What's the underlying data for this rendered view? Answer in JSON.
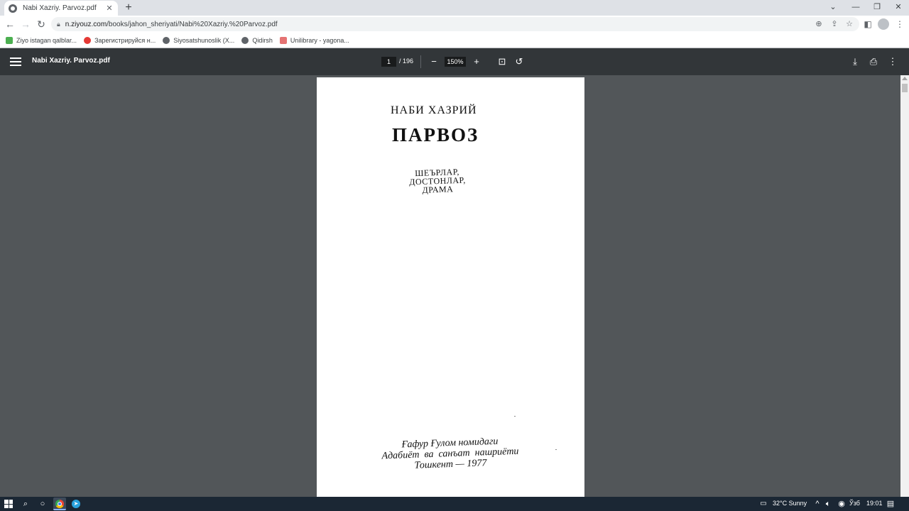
{
  "browser": {
    "tab_title": "Nabi Xazriy. Parvoz.pdf",
    "tab_close": "✕",
    "new_tab": "+",
    "url_host": "n.ziyouz.com",
    "url_path": "/books/jahon_sheriyati/Nabi%20Xazriy.%20Parvoz.pdf",
    "window_controls": [
      "⌄",
      "—",
      "❐",
      "✕"
    ]
  },
  "bookmarks": [
    {
      "label": "Ziyo istagan qalblar...",
      "color": "#4caf50"
    },
    {
      "label": "Зарегистрируйся н...",
      "color": "#e53935"
    },
    {
      "label": "Siyosatshunoslik (X...",
      "color": "#5f6368"
    },
    {
      "label": "Qidirsh",
      "color": "#5f6368"
    },
    {
      "label": "Unilibrary - yagona...",
      "color": "#e57373"
    }
  ],
  "pdf_viewer": {
    "title": "Nabi Xazriy. Parvoz.pdf",
    "page_current": "1",
    "page_total": "/ 196",
    "zoom": "150%"
  },
  "document": {
    "author": "НАБИ ХАЗРИЙ",
    "title": "ПАРВОЗ",
    "genres": [
      "ШЕЪРЛАР,",
      "ДОСТОНЛАР,",
      "ДРАМА"
    ],
    "publisher_lines": [
      "Ғафур Ғулом номидаги",
      "Адабиёт  ва  санъат  нашриёти",
      "Тошкент — 1977"
    ]
  },
  "taskbar": {
    "weather": "32°C  Sunny",
    "language": "Ўзб",
    "time": "19:01"
  }
}
